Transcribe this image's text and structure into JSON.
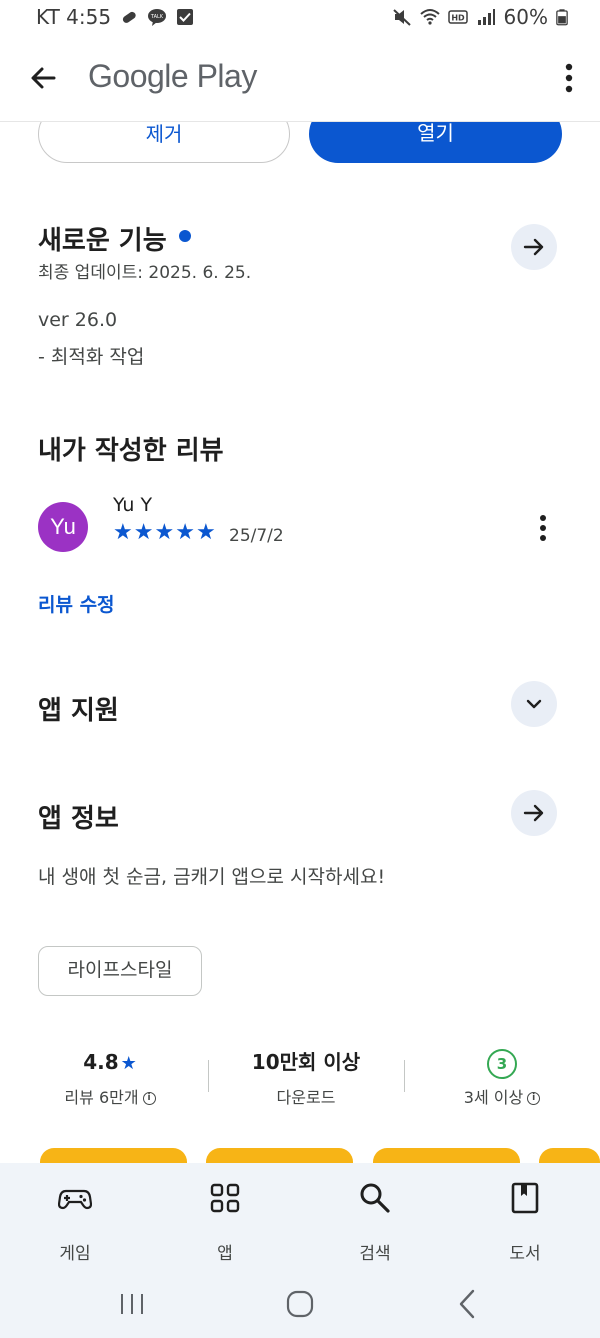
{
  "status_bar": {
    "carrier_time": "KT 4:55",
    "battery": "60%"
  },
  "app_bar": {
    "title": "Google Play"
  },
  "install_actions": {
    "remove_label": "제거",
    "open_label": "열기"
  },
  "whats_new": {
    "title": "새로운 기능",
    "last_updated": "최종 업데이트: 2025. 6. 25.",
    "version": "ver 26.0",
    "notes": "- 최적화 작업"
  },
  "my_review": {
    "title": "내가 작성한 리뷰",
    "avatar_initials": "Yu",
    "reviewer": "Yu Y",
    "rating": 5,
    "date": "25/7/2",
    "edit_label": "리뷰 수정"
  },
  "app_support": {
    "title": "앱 지원"
  },
  "app_info": {
    "title": "앱 정보",
    "description": "내 생애 첫 순금, 금캐기 앱으로 시작하세요!",
    "category_chip": "라이프스타일"
  },
  "stats": {
    "rating_value": "4.8",
    "rating_label": "리뷰 6만개",
    "downloads_value": "10만회 이상",
    "downloads_label": "다운로드",
    "age_badge": "3",
    "age_label": "3세 이상"
  },
  "colors": {
    "accent": "#0b57d0",
    "avatar": "#9b32c4",
    "age_badge": "#34a853",
    "screenshot_strip": "#f7b416",
    "nav_background": "#f0f4f9"
  },
  "bottom_nav": {
    "items": [
      {
        "label": "게임",
        "icon": "gamepad-icon"
      },
      {
        "label": "앱",
        "icon": "apps-grid-icon"
      },
      {
        "label": "검색",
        "icon": "search-icon"
      },
      {
        "label": "도서",
        "icon": "book-icon"
      }
    ]
  }
}
